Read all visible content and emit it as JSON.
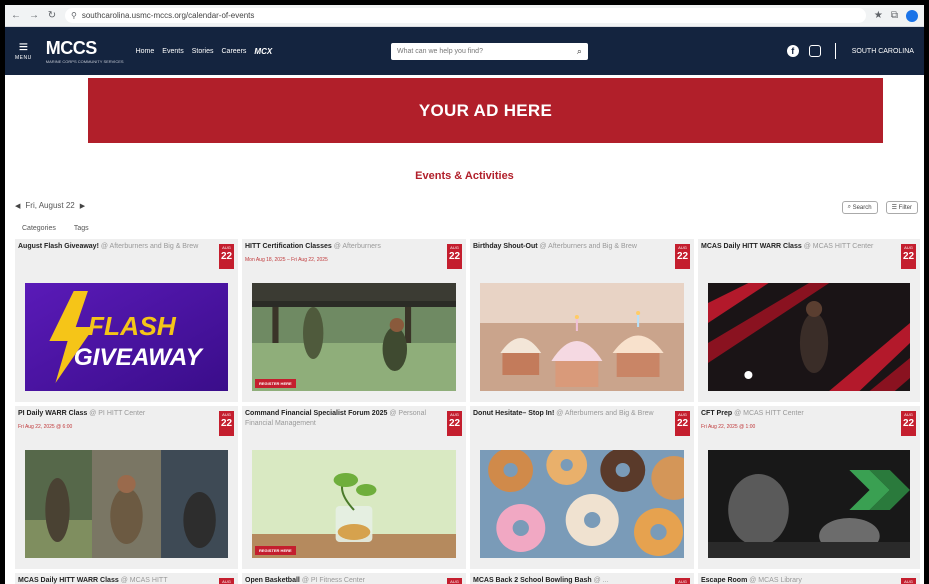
{
  "browser": {
    "url": "southcarolina.usmc-mccs.org/calendar-of-events"
  },
  "header": {
    "menu_label": "MENU",
    "logo": "MCCS",
    "logo_sub": "MARINE CORPS COMMUNITY SERVICES",
    "nav": [
      "Home",
      "Events",
      "Stories",
      "Careers"
    ],
    "nav_brand": "MCX",
    "search_placeholder": "What can we help you find?",
    "region": "SOUTH CAROLINA"
  },
  "ad": {
    "text": "YOUR AD HERE"
  },
  "section_title": "Events & Activities",
  "date_nav": {
    "label": "Fri, August 22"
  },
  "tools": {
    "search": "Search",
    "filter": "Filter"
  },
  "filters": [
    "Categories",
    "Tags"
  ],
  "events": [
    {
      "title": "August Flash Giveaway!",
      "location": "@ Afterburners and Big & Brew",
      "date": "",
      "month": "AUG",
      "day": "22",
      "register": false,
      "thumb": "flash"
    },
    {
      "title": "HITT Certification Classes",
      "location": "@ Afterburners",
      "date": "Mon Aug 18, 2025 – Fri Aug 22, 2025",
      "month": "AUG",
      "day": "22",
      "register": true,
      "thumb": "hitt"
    },
    {
      "title": "Birthday Shout-Out",
      "location": "@ Afterburners and Big & Brew",
      "date": "",
      "month": "AUG",
      "day": "22",
      "register": false,
      "thumb": "cupcakes"
    },
    {
      "title": "MCAS Daily HITT WARR Class",
      "location": "@ MCAS HITT Center",
      "date": "",
      "month": "AUG",
      "day": "22",
      "register": false,
      "thumb": "mcas"
    },
    {
      "title": "PI Daily WARR Class",
      "location": "@ PI HITT Center",
      "date": "Fri Aug 22, 2025 @ 6:00",
      "month": "AUG",
      "day": "22",
      "register": false,
      "thumb": "pi"
    },
    {
      "title": "Command Financial Specialist Forum 2025",
      "location": "@ Personal Financial Management",
      "date": "",
      "month": "AUG",
      "day": "22",
      "register": true,
      "thumb": "finance"
    },
    {
      "title": "Donut Hesitate– Stop In!",
      "location": "@ Afterburners and Big & Brew",
      "date": "",
      "month": "AUG",
      "day": "22",
      "register": false,
      "thumb": "donut"
    },
    {
      "title": "CFT Prep",
      "location": "@ MCAS HITT Center",
      "date": "Fri Aug 22, 2025 @ 1:00",
      "month": "AUG",
      "day": "22",
      "register": false,
      "thumb": "cft"
    },
    {
      "title": "MCAS Daily HITT WARR Class",
      "location": "@ MCAS HITT",
      "date": "",
      "month": "AUG",
      "day": "22",
      "register": false,
      "thumb": "none"
    },
    {
      "title": "Open Basketball",
      "location": "@ PI Fitness Center",
      "date": "",
      "month": "AUG",
      "day": "22",
      "register": false,
      "thumb": "none"
    },
    {
      "title": "MCAS Back 2 School Bowling Bash",
      "location": "@ ...",
      "date": "",
      "month": "AUG",
      "day": "22",
      "register": false,
      "thumb": "none"
    },
    {
      "title": "Escape Room",
      "location": "@ MCAS Library",
      "date": "",
      "month": "AUG",
      "day": "22",
      "register": false,
      "thumb": "none"
    }
  ],
  "flash_text": {
    "l1": "FLASH",
    "l2": "GIVEAWAY"
  },
  "register_label": "REGISTER HERE",
  "colors": {
    "navy": "#14243f",
    "brand_red": "#b11f2a",
    "badge_red": "#c41e2e"
  }
}
